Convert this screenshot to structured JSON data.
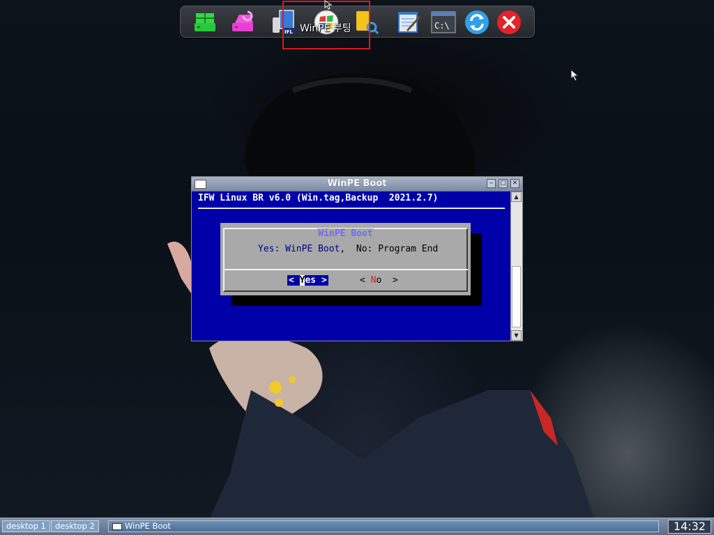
{
  "desktop": {
    "dock": {
      "icons": [
        "partition-manager-green-icon",
        "disk-recovery-pink-icon",
        "ifl-backup-icon",
        "winpe-boot-icon",
        "file-search-icon",
        "notepad-icon",
        "command-prompt-icon",
        "refresh-icon",
        "close-red-icon"
      ],
      "tooltip": "WinPE 부팅"
    }
  },
  "window": {
    "title": "WinPE Boot",
    "terminal": {
      "header": "IFW Linux BR v6.0 (Win.tag,Backup  2021.2.7)"
    },
    "dialog": {
      "title": "WinPE Boot",
      "message_yes": "Yes: WinPE Boot",
      "message_sep": ",  ",
      "message_no": "No: Program End",
      "yes_button": {
        "pre": "< ",
        "hot": "Y",
        "post": "es >"
      },
      "no_button": {
        "pre": "< ",
        "hot": "N",
        "post": "o  >"
      }
    }
  },
  "taskbar": {
    "desktops": [
      "desktop 1",
      "desktop 2"
    ],
    "tasks": [
      "WinPE Boot"
    ],
    "clock": "14:32"
  },
  "colors": {
    "terminal_bg": "#0000a8",
    "dialog_bg": "#a9a9a9",
    "highlight": "#e01818",
    "hotkey_no": "#d82222"
  }
}
